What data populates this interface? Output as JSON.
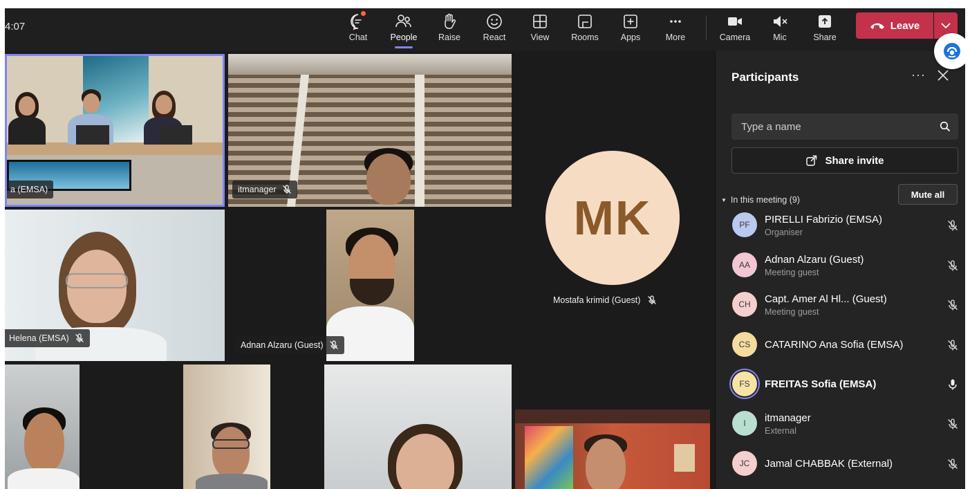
{
  "clock": "4:07",
  "toolbar": {
    "chat": "Chat",
    "people": "People",
    "raise": "Raise",
    "react": "React",
    "view": "View",
    "rooms": "Rooms",
    "apps": "Apps",
    "more": "More",
    "camera": "Camera",
    "mic": "Mic",
    "share": "Share",
    "leave": "Leave"
  },
  "tiles": {
    "conference_room": "a (EMSA)",
    "itmanager": "itmanager",
    "helena": "Helena (EMSA)",
    "adnan": "Adnan Alzaru (Guest)",
    "mostafa": {
      "initials": "MK",
      "name": "Mostafa krimid (Guest)"
    }
  },
  "panel": {
    "title": "Participants",
    "search_placeholder": "Type a name",
    "share_invite": "Share invite",
    "in_meeting": "In this meeting (9)",
    "mute_all": "Mute all",
    "participants": [
      {
        "initials": "PF",
        "name": "PIRELLI Fabrizio (EMSA)",
        "role": "Organiser",
        "color": "#b9c9ef",
        "mic": "muted"
      },
      {
        "initials": "AA",
        "name": "Adnan Alzaru (Guest)",
        "role": "Meeting guest",
        "color": "#f2c6d3",
        "mic": "muted"
      },
      {
        "initials": "CH",
        "name": "Capt. Amer Al Hl... (Guest)",
        "role": "Meeting guest",
        "color": "#f5cfcf",
        "mic": "muted"
      },
      {
        "initials": "CS",
        "name": "CATARINO Ana Sofia (EMSA)",
        "role": "",
        "color": "#f3dc9e",
        "mic": "muted"
      },
      {
        "initials": "FS",
        "name": "FREITAS Sofia (EMSA)",
        "role": "",
        "color": "#f6e3a6",
        "mic": "on"
      },
      {
        "initials": "I",
        "name": "itmanager",
        "role": "External",
        "color": "#b8dfcf",
        "mic": "muted"
      },
      {
        "initials": "JC",
        "name": "Jamal CHABBAK (External)",
        "role": "",
        "color": "#f5cfcf",
        "mic": "muted"
      }
    ]
  },
  "colors": {
    "accent": "#7f85f5",
    "leave": "#c4314b",
    "mk_avatar": "#f7dcc4",
    "mk_text": "#8a5a2b"
  }
}
